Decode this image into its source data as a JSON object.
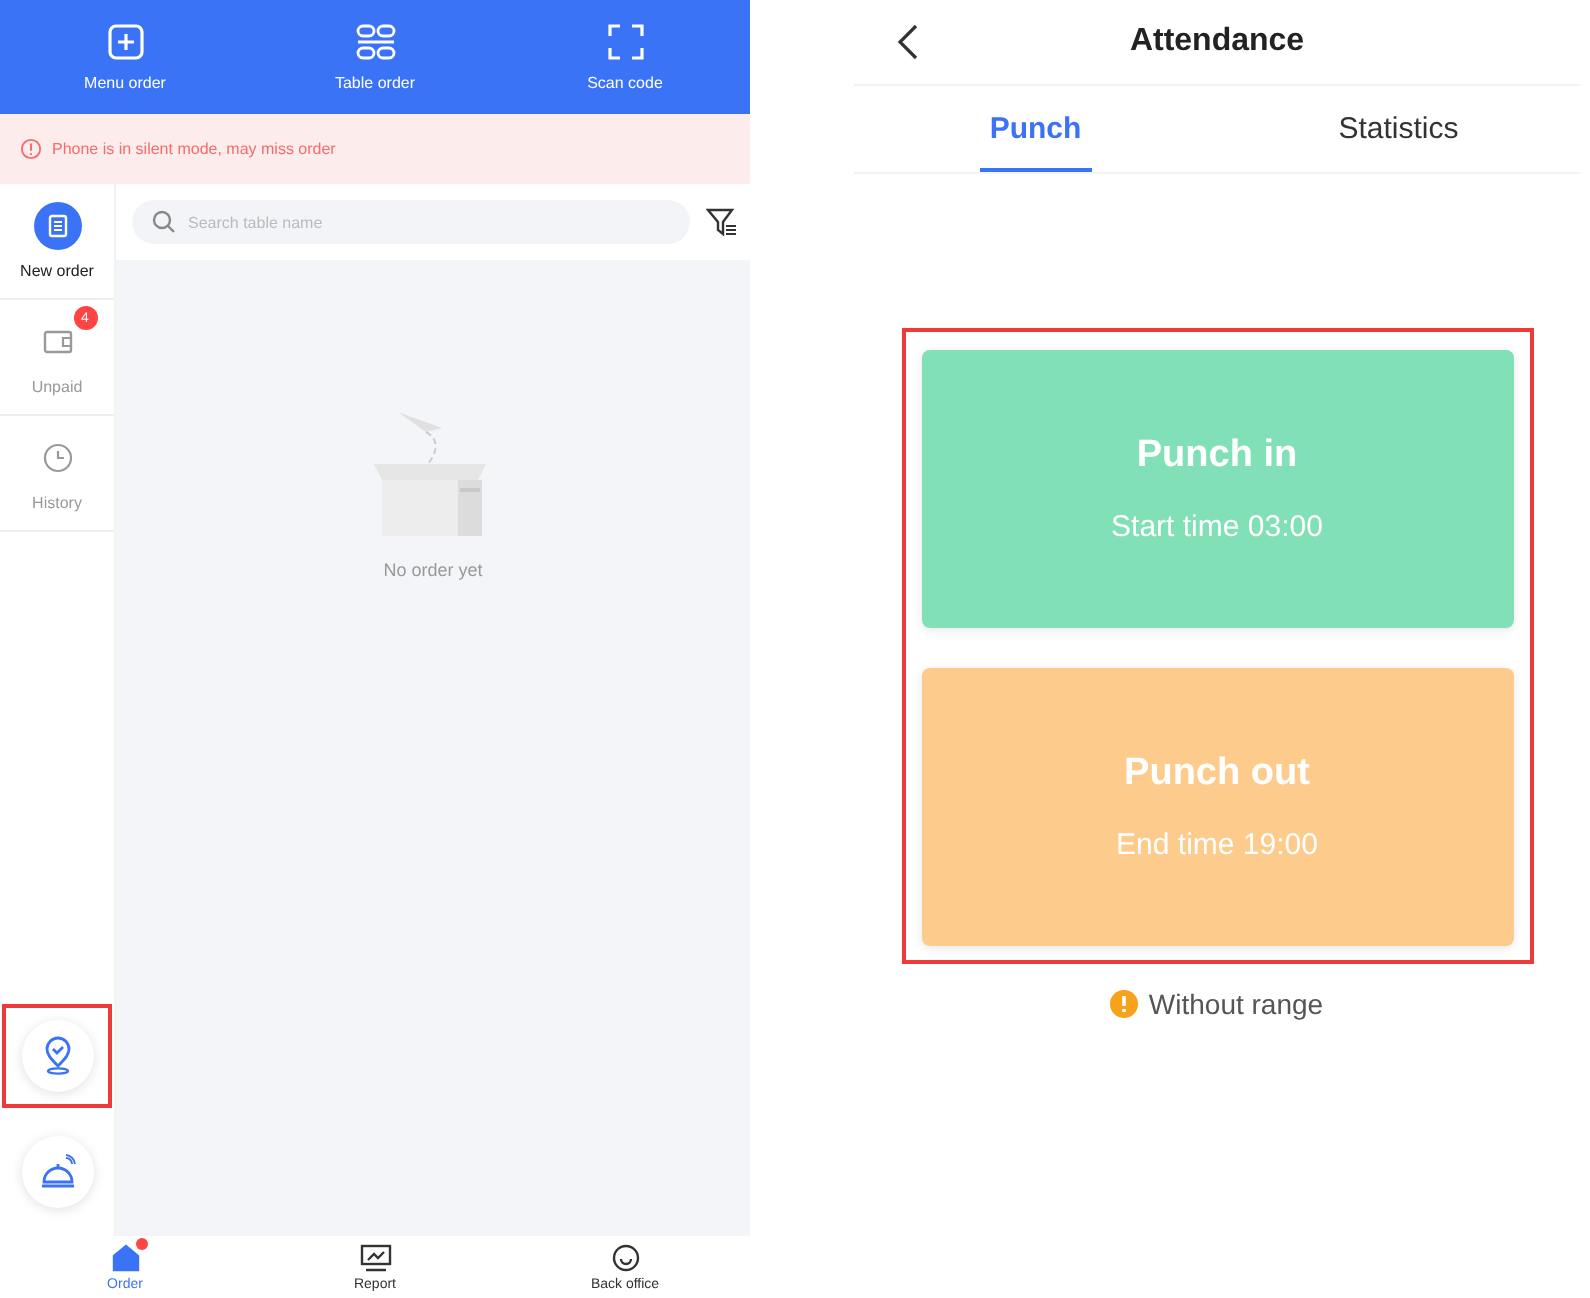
{
  "order_screen": {
    "header_actions": [
      {
        "kind": "plus",
        "label": "Menu order"
      },
      {
        "kind": "table",
        "label": "Table order"
      },
      {
        "kind": "scan",
        "label": "Scan code"
      }
    ],
    "banner": "Phone is in silent mode, may miss order",
    "sidebar": {
      "items": [
        {
          "kind": "doc",
          "label": "New order",
          "selected": true
        },
        {
          "kind": "wallet",
          "label": "Unpaid",
          "selected": false,
          "badge": "4"
        },
        {
          "kind": "clock",
          "label": "History",
          "selected": false
        }
      ]
    },
    "search": {
      "placeholder": "Search table name"
    },
    "empty_text": "No order yet",
    "floating_buttons": [
      {
        "kind": "checkin",
        "highlighted": true
      },
      {
        "kind": "bell",
        "highlighted": false
      }
    ],
    "bottom_nav": [
      {
        "kind": "home",
        "label": "Order",
        "selected": true,
        "dot": true
      },
      {
        "kind": "chart",
        "label": "Report",
        "selected": false,
        "dot": false
      },
      {
        "kind": "smile",
        "label": "Back office",
        "selected": false,
        "dot": false
      }
    ]
  },
  "attendance_screen": {
    "title": "Attendance",
    "tabs": [
      {
        "label": "Punch",
        "selected": true
      },
      {
        "label": "Statistics",
        "selected": false
      }
    ],
    "punch_panel_highlighted": true,
    "cards": [
      {
        "title": "Punch in",
        "subtitle": "Start time 03:00",
        "color": "#82e0b7"
      },
      {
        "title": "Punch out",
        "subtitle": "End time 19:00",
        "color": "#fdcc8d"
      }
    ],
    "notice": "Without range"
  }
}
